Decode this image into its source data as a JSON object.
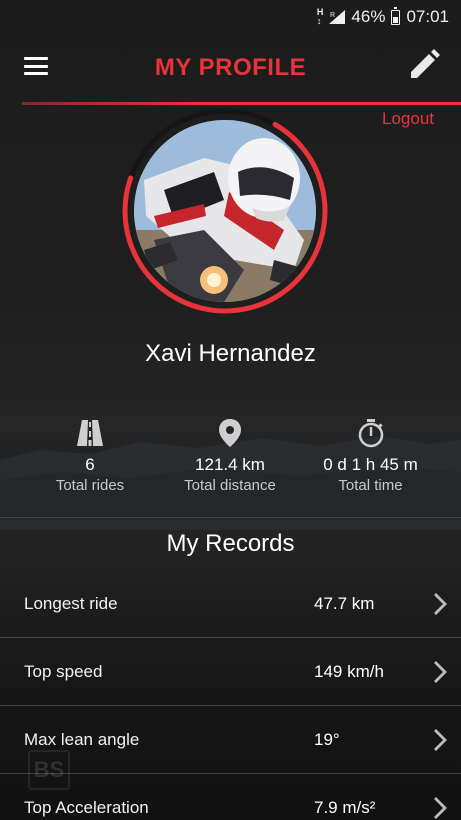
{
  "status_bar": {
    "network_top": "H",
    "network_bottom": "↕",
    "signal_marker": "R",
    "battery": "46%",
    "time": "07:01"
  },
  "header": {
    "title": "MY PROFILE",
    "logout_label": "Logout",
    "accent_color": "#e8333a"
  },
  "profile": {
    "name": "Xavi Hernandez",
    "avatar_progress": 0.72
  },
  "stats": [
    {
      "icon": "road-icon",
      "value": "6",
      "label": "Total rides"
    },
    {
      "icon": "location-pin-icon",
      "value": "121.4 km",
      "label": "Total distance"
    },
    {
      "icon": "stopwatch-icon",
      "value": "0 d 1 h 45 m",
      "label": "Total time"
    }
  ],
  "records": {
    "title": "My Records",
    "items": [
      {
        "label": "Longest ride",
        "value": "47.7 km"
      },
      {
        "label": "Top speed",
        "value": "149 km/h"
      },
      {
        "label": "Max lean angle",
        "value": "19°"
      },
      {
        "label": "Top Acceleration",
        "value": "7.9 m/s²"
      }
    ]
  },
  "watermark": "BS"
}
